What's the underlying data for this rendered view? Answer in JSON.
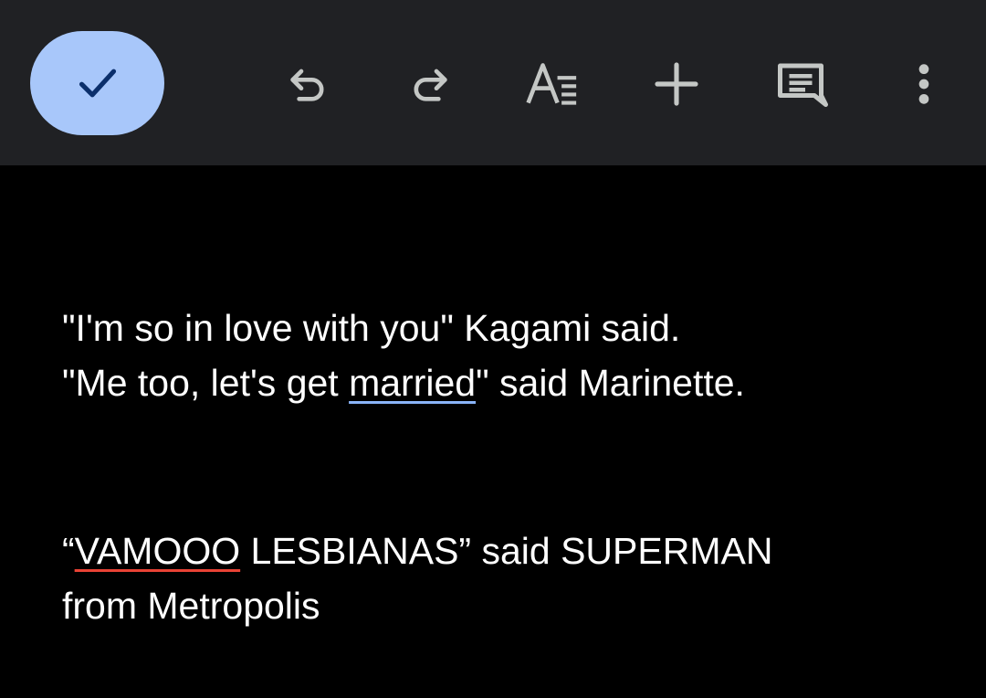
{
  "toolbar": {
    "done_icon": "check-icon",
    "tools": [
      {
        "icon": "undo-icon"
      },
      {
        "icon": "redo-icon"
      },
      {
        "icon": "text-format-icon"
      },
      {
        "icon": "insert-plus-icon"
      },
      {
        "icon": "comment-icon"
      },
      {
        "icon": "more-vert-icon"
      }
    ],
    "colors": {
      "toolbar_bg": "#202124",
      "done_bg": "#a8c7fa",
      "done_icon": "#0b2f6b",
      "icon": "#c4c7c5"
    }
  },
  "document": {
    "paragraph1": {
      "line1": "\"I'm so in love with you\" Kagami said.",
      "line2_before": "\"Me too, let's get ",
      "line2_flagged": "married",
      "line2_after": "\" said Marinette."
    },
    "paragraph2": {
      "line1_open_quote": "“",
      "line1_flagged": "VAMOOO",
      "line1_after": " LESBIANAS” said SUPERMAN",
      "line2": "from Metropolis"
    },
    "colors": {
      "text": "#ffffff",
      "background": "#000000",
      "grammar_underline": "#8ab4f8",
      "spelling_underline": "#e94235"
    }
  }
}
